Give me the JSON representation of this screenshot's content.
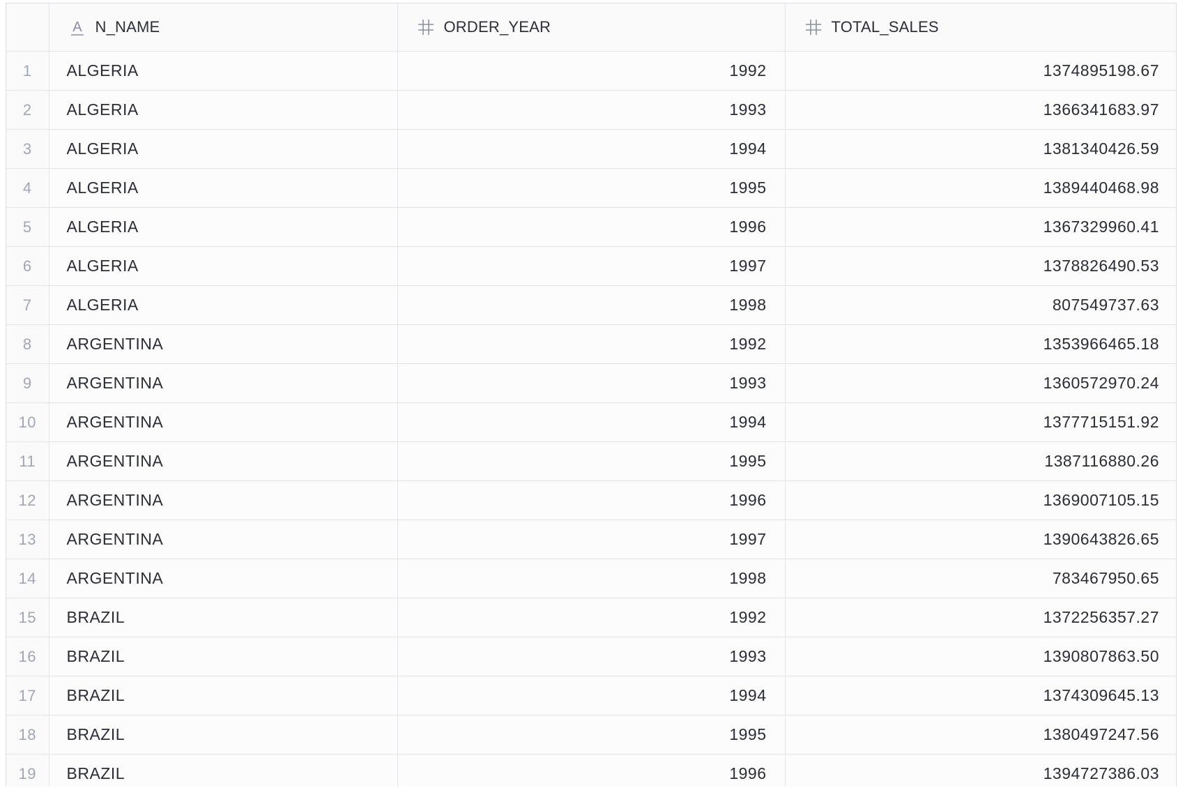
{
  "table": {
    "columns": [
      {
        "label": "N_NAME",
        "type_icon": "text-type-icon"
      },
      {
        "label": "ORDER_YEAR",
        "type_icon": "number-type-icon"
      },
      {
        "label": "TOTAL_SALES",
        "type_icon": "number-type-icon"
      }
    ],
    "rows": [
      {
        "index": "1",
        "n_name": "ALGERIA",
        "order_year": "1992",
        "total_sales": "1374895198.67"
      },
      {
        "index": "2",
        "n_name": "ALGERIA",
        "order_year": "1993",
        "total_sales": "1366341683.97"
      },
      {
        "index": "3",
        "n_name": "ALGERIA",
        "order_year": "1994",
        "total_sales": "1381340426.59"
      },
      {
        "index": "4",
        "n_name": "ALGERIA",
        "order_year": "1995",
        "total_sales": "1389440468.98"
      },
      {
        "index": "5",
        "n_name": "ALGERIA",
        "order_year": "1996",
        "total_sales": "1367329960.41"
      },
      {
        "index": "6",
        "n_name": "ALGERIA",
        "order_year": "1997",
        "total_sales": "1378826490.53"
      },
      {
        "index": "7",
        "n_name": "ALGERIA",
        "order_year": "1998",
        "total_sales": "807549737.63"
      },
      {
        "index": "8",
        "n_name": "ARGENTINA",
        "order_year": "1992",
        "total_sales": "1353966465.18"
      },
      {
        "index": "9",
        "n_name": "ARGENTINA",
        "order_year": "1993",
        "total_sales": "1360572970.24"
      },
      {
        "index": "10",
        "n_name": "ARGENTINA",
        "order_year": "1994",
        "total_sales": "1377715151.92"
      },
      {
        "index": "11",
        "n_name": "ARGENTINA",
        "order_year": "1995",
        "total_sales": "1387116880.26"
      },
      {
        "index": "12",
        "n_name": "ARGENTINA",
        "order_year": "1996",
        "total_sales": "1369007105.15"
      },
      {
        "index": "13",
        "n_name": "ARGENTINA",
        "order_year": "1997",
        "total_sales": "1390643826.65"
      },
      {
        "index": "14",
        "n_name": "ARGENTINA",
        "order_year": "1998",
        "total_sales": "783467950.65"
      },
      {
        "index": "15",
        "n_name": "BRAZIL",
        "order_year": "1992",
        "total_sales": "1372256357.27"
      },
      {
        "index": "16",
        "n_name": "BRAZIL",
        "order_year": "1993",
        "total_sales": "1390807863.50"
      },
      {
        "index": "17",
        "n_name": "BRAZIL",
        "order_year": "1994",
        "total_sales": "1374309645.13"
      },
      {
        "index": "18",
        "n_name": "BRAZIL",
        "order_year": "1995",
        "total_sales": "1380497247.56"
      },
      {
        "index": "19",
        "n_name": "BRAZIL",
        "order_year": "1996",
        "total_sales": "1394727386.03"
      }
    ]
  },
  "colors": {
    "header_text": "#2c2f38",
    "cell_text": "#2a2d35",
    "row_index_text": "#a0a6b4",
    "grid_line": "#e4e5ea",
    "background": "#fafafb",
    "type_icon": "#8a90a0"
  }
}
